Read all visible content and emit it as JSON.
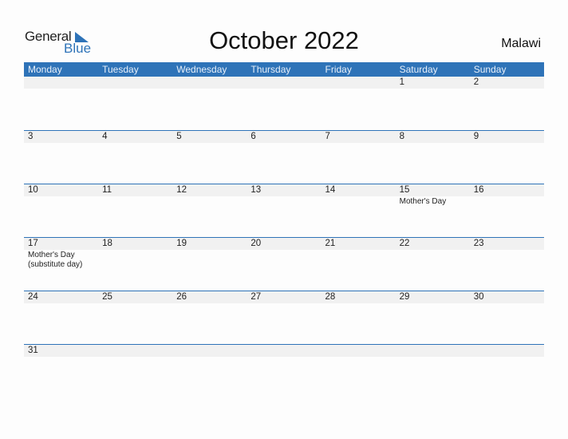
{
  "logo": {
    "general": "General",
    "blue": "Blue"
  },
  "title": "October 2022",
  "country": "Malawi",
  "weekdays": [
    "Monday",
    "Tuesday",
    "Wednesday",
    "Thursday",
    "Friday",
    "Saturday",
    "Sunday"
  ],
  "weeks": [
    [
      {
        "day": ""
      },
      {
        "day": ""
      },
      {
        "day": ""
      },
      {
        "day": ""
      },
      {
        "day": ""
      },
      {
        "day": "1"
      },
      {
        "day": "2"
      }
    ],
    [
      {
        "day": "3"
      },
      {
        "day": "4"
      },
      {
        "day": "5"
      },
      {
        "day": "6"
      },
      {
        "day": "7"
      },
      {
        "day": "8"
      },
      {
        "day": "9"
      }
    ],
    [
      {
        "day": "10"
      },
      {
        "day": "11"
      },
      {
        "day": "12"
      },
      {
        "day": "13"
      },
      {
        "day": "14"
      },
      {
        "day": "15",
        "event": "Mother's Day"
      },
      {
        "day": "16"
      }
    ],
    [
      {
        "day": "17",
        "event": "Mother's Day (substitute day)"
      },
      {
        "day": "18"
      },
      {
        "day": "19"
      },
      {
        "day": "20"
      },
      {
        "day": "21"
      },
      {
        "day": "22"
      },
      {
        "day": "23"
      }
    ],
    [
      {
        "day": "24"
      },
      {
        "day": "25"
      },
      {
        "day": "26"
      },
      {
        "day": "27"
      },
      {
        "day": "28"
      },
      {
        "day": "29"
      },
      {
        "day": "30"
      }
    ],
    [
      {
        "day": "31"
      },
      {
        "day": ""
      },
      {
        "day": ""
      },
      {
        "day": ""
      },
      {
        "day": ""
      },
      {
        "day": ""
      },
      {
        "day": ""
      }
    ]
  ],
  "colors": {
    "accent": "#2e73b8",
    "band": "#f1f1f1"
  }
}
